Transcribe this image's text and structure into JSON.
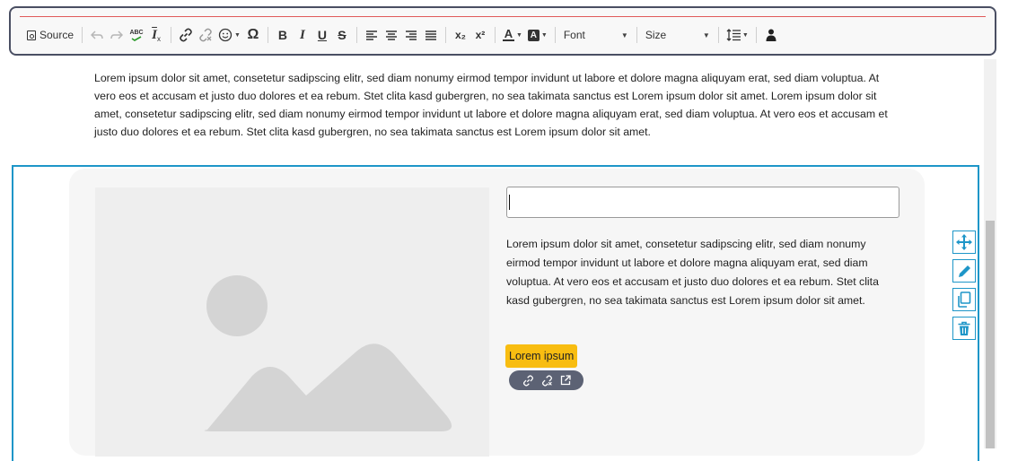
{
  "toolbar": {
    "source_label": "Source",
    "font_label": "Font",
    "size_label": "Size",
    "items": [
      "undo-icon",
      "redo-icon",
      "spellcheck-icon",
      "remove-format-icon",
      "link-icon",
      "unlink-icon",
      "emoji-icon",
      "special-char-icon",
      "bold-icon",
      "italic-icon",
      "underline-icon",
      "strikethrough-icon",
      "align-left-icon",
      "align-center-icon",
      "align-right-icon",
      "justify-icon",
      "subscript-icon",
      "superscript-icon",
      "text-color-icon",
      "background-color-icon",
      "line-height-icon",
      "user-icon"
    ]
  },
  "glyphs": {
    "omega": "Ω",
    "bold": "B",
    "italic": "I",
    "underline": "U",
    "strike": "S",
    "sub": "x₂",
    "sup": "x²",
    "textcolor": "A",
    "bgcolor": "A",
    "ix": "I",
    "abc": "ABC"
  },
  "content": {
    "top_paragraph": "Lorem ipsum dolor sit amet, consetetur sadipscing elitr, sed diam nonumy eirmod tempor invidunt ut labore et dolore magna aliquyam erat, sed diam voluptua. At vero eos et accusam et justo duo dolores et ea rebum. Stet clita kasd gubergren, no sea takimata sanctus est Lorem ipsum dolor sit amet. Lorem ipsum dolor sit amet, consetetur sadipscing elitr, sed diam nonumy eirmod tempor invidunt ut labore et dolore magna aliquyam erat, sed diam voluptua. At vero eos et accusam et justo duo dolores et ea rebum. Stet clita kasd gubergren, no sea takimata sanctus est Lorem ipsum dolor sit amet.",
    "card_text": "Lorem ipsum dolor sit amet, consetetur sadipscing elitr, sed diam nonumy eirmod tempor invidunt ut labore et dolore magna aliquyam erat, sed diam voluptua. At vero eos et accusam et justo duo dolores et ea rebum. Stet clita kasd gubergren, no sea takimata sanctus est Lorem ipsum dolor sit amet.",
    "title_value": "",
    "button_label": "Lorem ipsum"
  },
  "widget_tools": [
    "move-icon",
    "edit-icon",
    "duplicate-icon",
    "delete-icon"
  ],
  "link_tools": [
    "link-icon",
    "unlink-icon",
    "open-external-icon"
  ],
  "colors": {
    "accent": "#1e96c8",
    "button_bg": "#f8bd11",
    "pill_bg": "#5c6274",
    "card_bg": "#f6f6f6",
    "placeholder": "#d4d4d4"
  }
}
